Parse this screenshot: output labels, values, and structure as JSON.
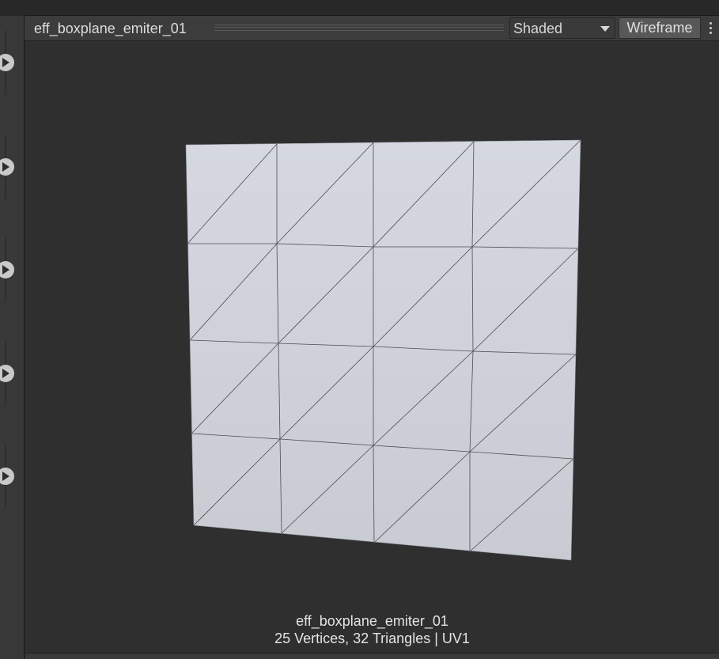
{
  "preview": {
    "title": "eff_boxplane_emiter_01",
    "shading_mode": "Shaded",
    "wireframe_label": "Wireframe",
    "more_icon": "vertical-ellipsis-icon"
  },
  "sidebar": {
    "expanders": [
      {
        "icon": "play-icon"
      },
      {
        "icon": "play-icon"
      },
      {
        "icon": "play-icon"
      },
      {
        "icon": "play-icon"
      },
      {
        "icon": "play-icon"
      }
    ]
  },
  "mesh_info": {
    "name": "eff_boxplane_emiter_01",
    "stats": "25 Vertices, 32 Triangles | UV1"
  },
  "colors": {
    "mesh_fill": "#d3d6df",
    "wire": "#4a4c52",
    "background": "#2f2f2f"
  }
}
